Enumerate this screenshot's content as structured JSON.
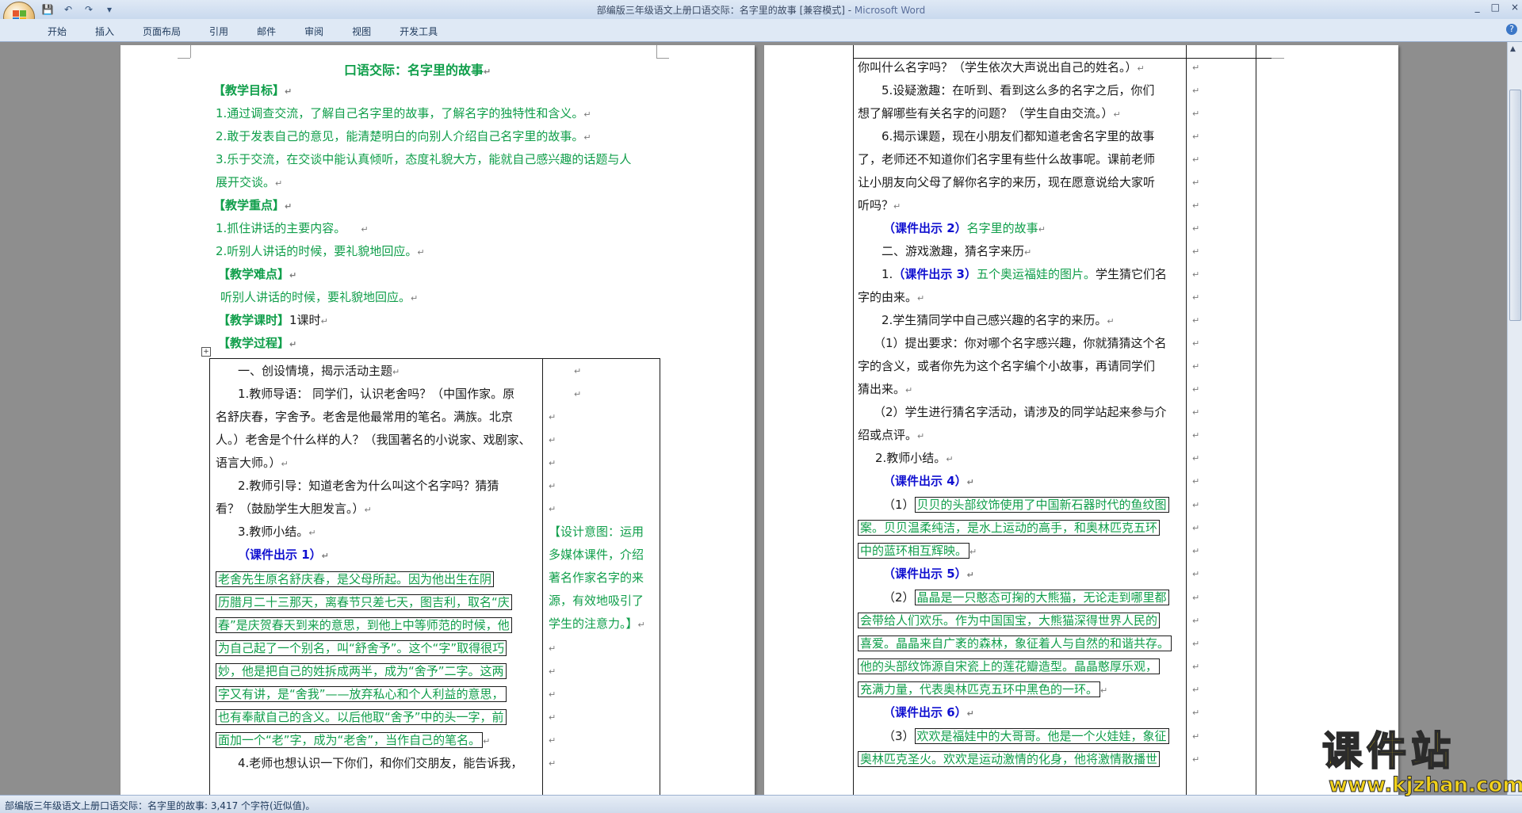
{
  "window": {
    "title": "部编版三年级语文上册口语交际：名字里的故事 [兼容模式] - ",
    "app_name": "Microsoft Word",
    "controls": [
      "_",
      "□",
      "×"
    ]
  },
  "qat": {
    "save": "💾",
    "undo": "↶",
    "redo": "↷",
    "more": "▾"
  },
  "tabs": [
    "开始",
    "插入",
    "页面布局",
    "引用",
    "邮件",
    "审阅",
    "视图",
    "开发工具"
  ],
  "help": "?",
  "status": {
    "text": "部编版三年级语文上册口语交际：名字里的故事: 3,417 个字符(近似值)。"
  },
  "watermark": {
    "title": "课件站",
    "url": "www.kjzhan.com"
  },
  "pilcrow": "↵",
  "page1": {
    "title": "口语交际：名字里的故事",
    "goal_head": "【教学目标】",
    "goals": [
      "1.通过调查交流，了解自己名字里的故事，了解名字的独特性和含义。",
      "2.敢于发表自己的意见，能清楚明白的向别人介绍自己名字里的故事。",
      "3.乐于交流，在交谈中能认真倾听，态度礼貌大方，能就自己感兴趣的话题与人",
      "展开交谈。"
    ],
    "key_head": "【教学重点】",
    "keys": [
      "1.抓住讲话的主要内容。",
      "2.听别人讲话的时候，要礼貌地回应。"
    ],
    "diff_head": "【教学难点】",
    "diff": "听别人讲话的时候，要礼貌地回应。",
    "hours_head": "【教学课时】",
    "hours": "1课时",
    "process_head": "【教学过程】",
    "cell_lines": [
      "一、创设情境，揭示活动主题",
      "1.教师导语： 同学们，认识老舍吗？（中国作家。原",
      "名舒庆春，字舍予。老舍是他最常用的笔名。满族。北京",
      "人。）老舍是个什么样的人？（我国著名的小说家、戏剧家、",
      "语言大师。）",
      "2.教师引导：知道老舍为什么叫这个名字吗？猜猜",
      "看？（鼓励学生大胆发言。）",
      "3.教师小结。"
    ],
    "courseware1": "（课件出示 1）",
    "boxed_lines": [
      "老舍先生原名舒庆春，是父母所起。因为他出生在阴",
      "历腊月二十三那天，离春节只差七天，图吉利，取名“庆",
      "春”是庆贺春天到来的意思，到他上中等师范的时候，他",
      "为自己起了一个别名，叫“舒舍予”。这个“字”取得很巧",
      "妙，他是把自己的姓拆成两半，成为“舍予”二字。这两",
      "字又有讲，是“舍我”——放弃私心和个人利益的意思，",
      "也有奉献自己的含义。以后他取“舍予”中的头一字，前",
      "面加一个“老”字，成为“老舍”，当作自己的笔名。"
    ],
    "last_line": "4.老师也想认识一下你们，和你们交朋友，能告诉我，",
    "design_lines": [
      "【设计意图：运用",
      "多媒体课件，介绍",
      "著名作家名字的来",
      "源，有效地吸引了",
      "学生的注意力。】"
    ]
  },
  "page2": {
    "lines_a": [
      "你叫什么名字吗？（学生依次大声说出自己的姓名。）",
      "5.设疑激趣：在听到、看到这么多的名字之后，你们",
      "想了解哪些有关名字的问题？（学生自由交流。）",
      "6.揭示课题，现在小朋友们都知道老舍名字里的故事",
      "了，老师还不知道你们名字里有些什么故事呢。课前老师",
      "让小朋友向父母了解你名字的来历，现在愿意说给大家听",
      "听吗？"
    ],
    "cw2": "（课件出示 2）",
    "cw2_text": "名字里的故事",
    "game": "二、游戏激趣，猜名字来历",
    "l1_pre": "1.",
    "cw3": "（课件出示 3）",
    "cw3_text": "五个奥运福娃的图片。",
    "l1_post": "学生猜它们名",
    "l1b": "字的由来。",
    "l2": "2.学生猜同学中自己感兴趣的名字的来历。",
    "req": [
      "（1）提出要求：你对哪个名字感兴趣，你就猜猜这个名",
      "字的含义，或者你先为这个名字编个小故事，再请同学们",
      "猜出来。",
      "（2）学生进行猜名字活动，请涉及的同学站起来参与介",
      "绍或点评。",
      "2.教师小结。"
    ],
    "cw4": "（课件出示 4）",
    "beibei_pre": "（1）",
    "beibei": [
      "贝贝的头部纹饰使用了中国新石器时代的鱼纹图",
      "案。贝贝温柔纯洁，是水上运动的高手，和奥林匹克五环",
      "中的蓝环相互辉映。"
    ],
    "cw5": "（课件出示 5）",
    "jingjing_pre": "（2）",
    "jingjing": [
      "晶晶是一只憨态可掬的大熊猫，无论走到哪里都",
      "会带给人们欢乐。作为中国国宝，大熊猫深得世界人民的",
      "喜爱。晶晶来自广袤的森林，象征着人与自然的和谐共存。",
      "他的头部纹饰源自宋瓷上的莲花瓣造型。晶晶憨厚乐观，",
      "充满力量，代表奥林匹克五环中黑色的一环。"
    ],
    "cw6": "（课件出示 6）",
    "huanhuan_pre": "（3）",
    "huanhuan": [
      "欢欢是福娃中的大哥哥。他是一个火娃娃，象征",
      "奥林匹克圣火。欢欢是运动激情的化身，他将激情散播世"
    ]
  }
}
